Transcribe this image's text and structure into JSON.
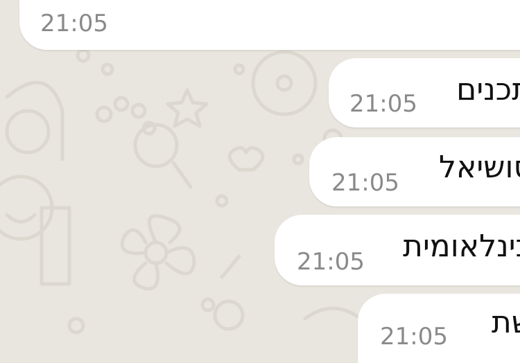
{
  "chat": {
    "messages": [
      {
        "text": "",
        "time": "21:05"
      },
      {
        "text": "תכנים",
        "time": "21:05"
      },
      {
        "text": "סושיאל",
        "time": "21:05"
      },
      {
        "text": "בינלאומית",
        "time": "21:05"
      },
      {
        "text": "שת",
        "time": "21:05"
      }
    ]
  },
  "theme": {
    "wallpaper_color": "#e9e6df",
    "bubble_color": "#ffffff",
    "text_color": "#111111",
    "time_color": "#8a8a8a"
  }
}
